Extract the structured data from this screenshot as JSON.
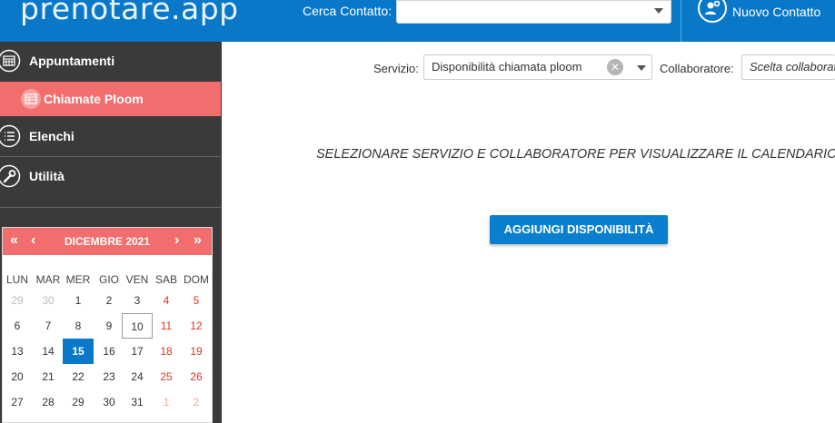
{
  "header": {
    "logo_main": "prenotare",
    "logo_dot": ".",
    "logo_tail": "app",
    "search_label": "Cerca Contatto:",
    "search_value": "",
    "new_contact_label": "Nuovo Contatto",
    "new_contact_icon": "add-user-icon"
  },
  "sidebar": {
    "items": [
      {
        "label": "Appuntamenti",
        "icon": "calendar-grid-icon"
      },
      {
        "label": "Chiamate Ploom",
        "icon": "table-icon",
        "active": true
      },
      {
        "label": "Elenchi",
        "icon": "list-icon"
      },
      {
        "label": "Utilità",
        "icon": "wrench-icon"
      }
    ]
  },
  "calendar": {
    "title": "DICEMBRE 2021",
    "nav": {
      "prev_year": "«",
      "prev_month": "‹",
      "next_month": "›",
      "next_year": "»"
    },
    "weekdays": [
      "LUN",
      "MAR",
      "MER",
      "GIO",
      "VEN",
      "SAB",
      "DOM"
    ],
    "weeks": [
      [
        "29",
        "30",
        "1",
        "2",
        "3",
        "4",
        "5"
      ],
      [
        "6",
        "7",
        "8",
        "9",
        "10",
        "11",
        "12"
      ],
      [
        "13",
        "14",
        "15",
        "16",
        "17",
        "18",
        "19"
      ],
      [
        "20",
        "21",
        "22",
        "23",
        "24",
        "25",
        "26"
      ],
      [
        "27",
        "28",
        "29",
        "30",
        "31",
        "1",
        "2"
      ]
    ],
    "selected_day": "15",
    "today_day": "10"
  },
  "filters": {
    "service_label": "Servizio:",
    "service_value": "Disponibilità chiamata ploom",
    "collaborator_label": "Collaboratore:",
    "collaborator_placeholder": "Scelta collaboratore"
  },
  "main": {
    "message": "SELEZIONARE SERVIZIO E COLLABORATORE PER VISUALIZZARE IL CALENDARIO",
    "add_button": "AGGIUNGI DISPONIBILITÀ"
  },
  "colors": {
    "header": "#0a78c8",
    "sidebar": "#3a3a3a",
    "accent_red": "#f26d6d",
    "primary_button": "#0a7fd0"
  }
}
